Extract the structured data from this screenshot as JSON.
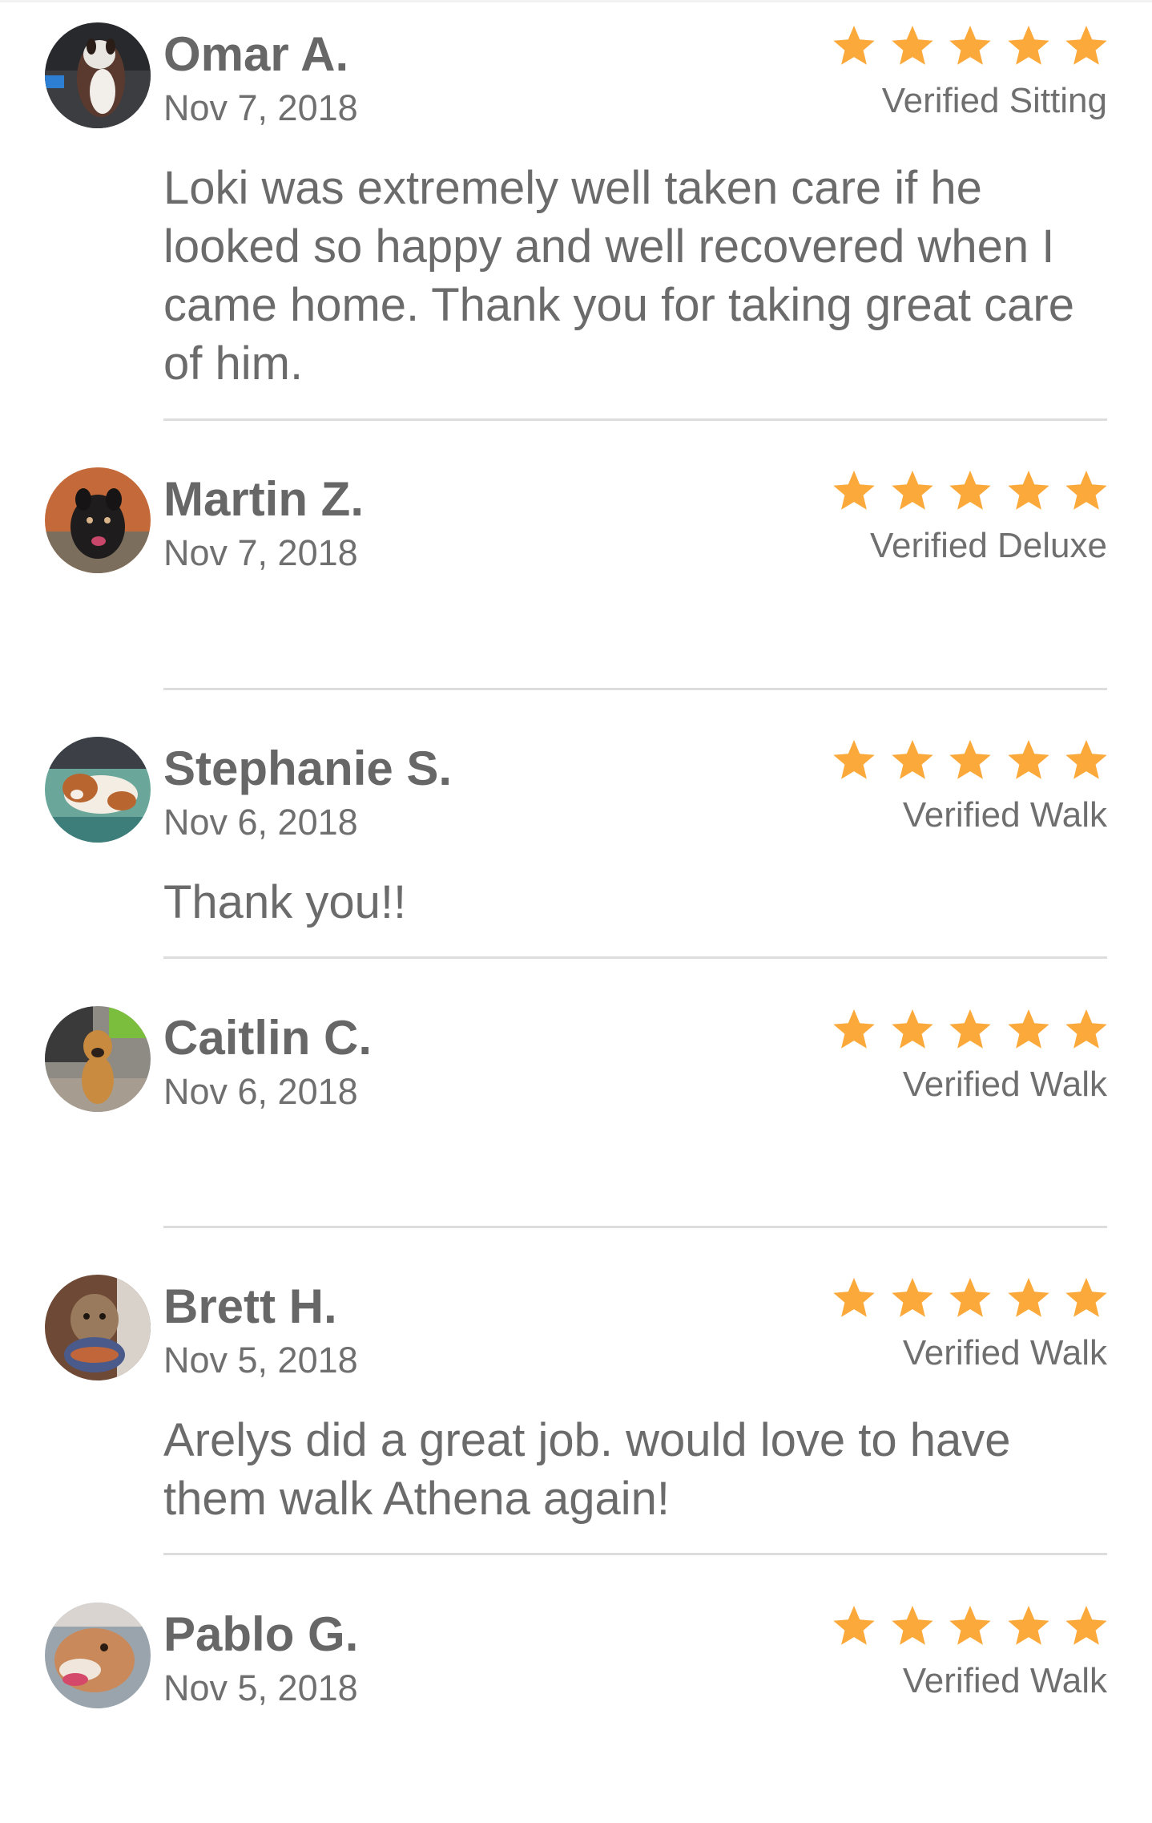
{
  "colors": {
    "star": "#fca93b",
    "text": "#676767",
    "divider": "#dddddd"
  },
  "reviews": [
    {
      "name": "Omar A.",
      "date": "Nov 7, 2018",
      "rating": 5,
      "service": "Verified Sitting",
      "comment": "Loki was extremely well taken care if he looked so happy and well recovered when I came home. Thank you for taking great care of him."
    },
    {
      "name": "Martin Z.",
      "date": "Nov 7, 2018",
      "rating": 5,
      "service": "Verified Deluxe",
      "comment": ""
    },
    {
      "name": "Stephanie S.",
      "date": "Nov 6, 2018",
      "rating": 5,
      "service": "Verified Walk",
      "comment": "Thank you!!"
    },
    {
      "name": "Caitlin C.",
      "date": "Nov 6, 2018",
      "rating": 5,
      "service": "Verified Walk",
      "comment": ""
    },
    {
      "name": "Brett H.",
      "date": "Nov 5, 2018",
      "rating": 5,
      "service": "Verified Walk",
      "comment": "Arelys did a great job. would love to have them walk Athena again!"
    },
    {
      "name": "Pablo G.",
      "date": "Nov 5, 2018",
      "rating": 5,
      "service": "Verified Walk",
      "comment": ""
    }
  ]
}
